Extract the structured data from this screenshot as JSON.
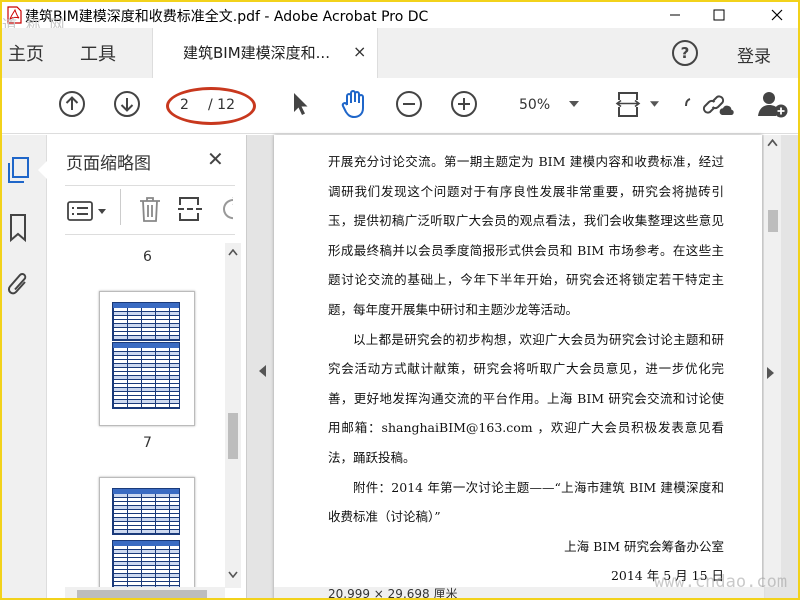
{
  "window": {
    "title": "建筑BIM建模深度和收费标准全文.pdf - Adobe Acrobat Pro DC",
    "watermark_topleft": "道 称 网",
    "watermark_bottomright": "www.cndao.com",
    "border_color": "#f2d21b"
  },
  "tabbar": {
    "home": "主页",
    "tools": "工具",
    "document_tab": "建筑BIM建模深度和...",
    "close_glyph": "×",
    "help_glyph": "?",
    "login": "登录"
  },
  "toolbar": {
    "current_page": "2",
    "total_pages": "/ 12",
    "zoom": "50%",
    "annotation_color": "#c8381e"
  },
  "thumbnail_panel": {
    "title": "页面缩略图",
    "close_glyph": "✕",
    "pages": [
      {
        "label": "6"
      },
      {
        "label": "7"
      }
    ]
  },
  "document": {
    "paragraphs": [
      {
        "style": "plain",
        "text": "开展充分讨论交流。第一期主题定为 BIM 建模内容和收费标准，经过调研我们发现这个问题对于有序良性发展非常重要，研究会将抛砖引玉，提供初稿广泛听取广大会员的观点看法，我们会收集整理这些意见形成最终稿并以会员季度简报形式供会员和 BIM 市场参考。在这些主题讨论交流的基础上，今年下半年开始，研究会还将锁定若干特定主题，每年度开展集中研讨和主题沙龙等活动。"
      },
      {
        "style": "indent",
        "text": "以上都是研究会的初步构想，欢迎广大会员为研究会讨论主题和研究会活动方式献计献策，研究会将听取广大会员意见，进一步优化完善，更好地发挥沟通交流的平台作用。上海 BIM 研究会交流和讨论使用邮箱：shanghaiBIM@163.com ，欢迎广大会员积极发表意见看法，踊跃投稿。"
      },
      {
        "style": "indent",
        "text": "附件：2014 年第一次讨论主题——“上海市建筑 BIM 建模深度和收费标准（讨论稿）”"
      },
      {
        "style": "right",
        "text": "上海 BIM 研究会筹备办公室"
      },
      {
        "style": "right",
        "text": "2014 年 5 月 15 日"
      }
    ],
    "page_dimensions": "20.999 × 29.698 厘米"
  }
}
